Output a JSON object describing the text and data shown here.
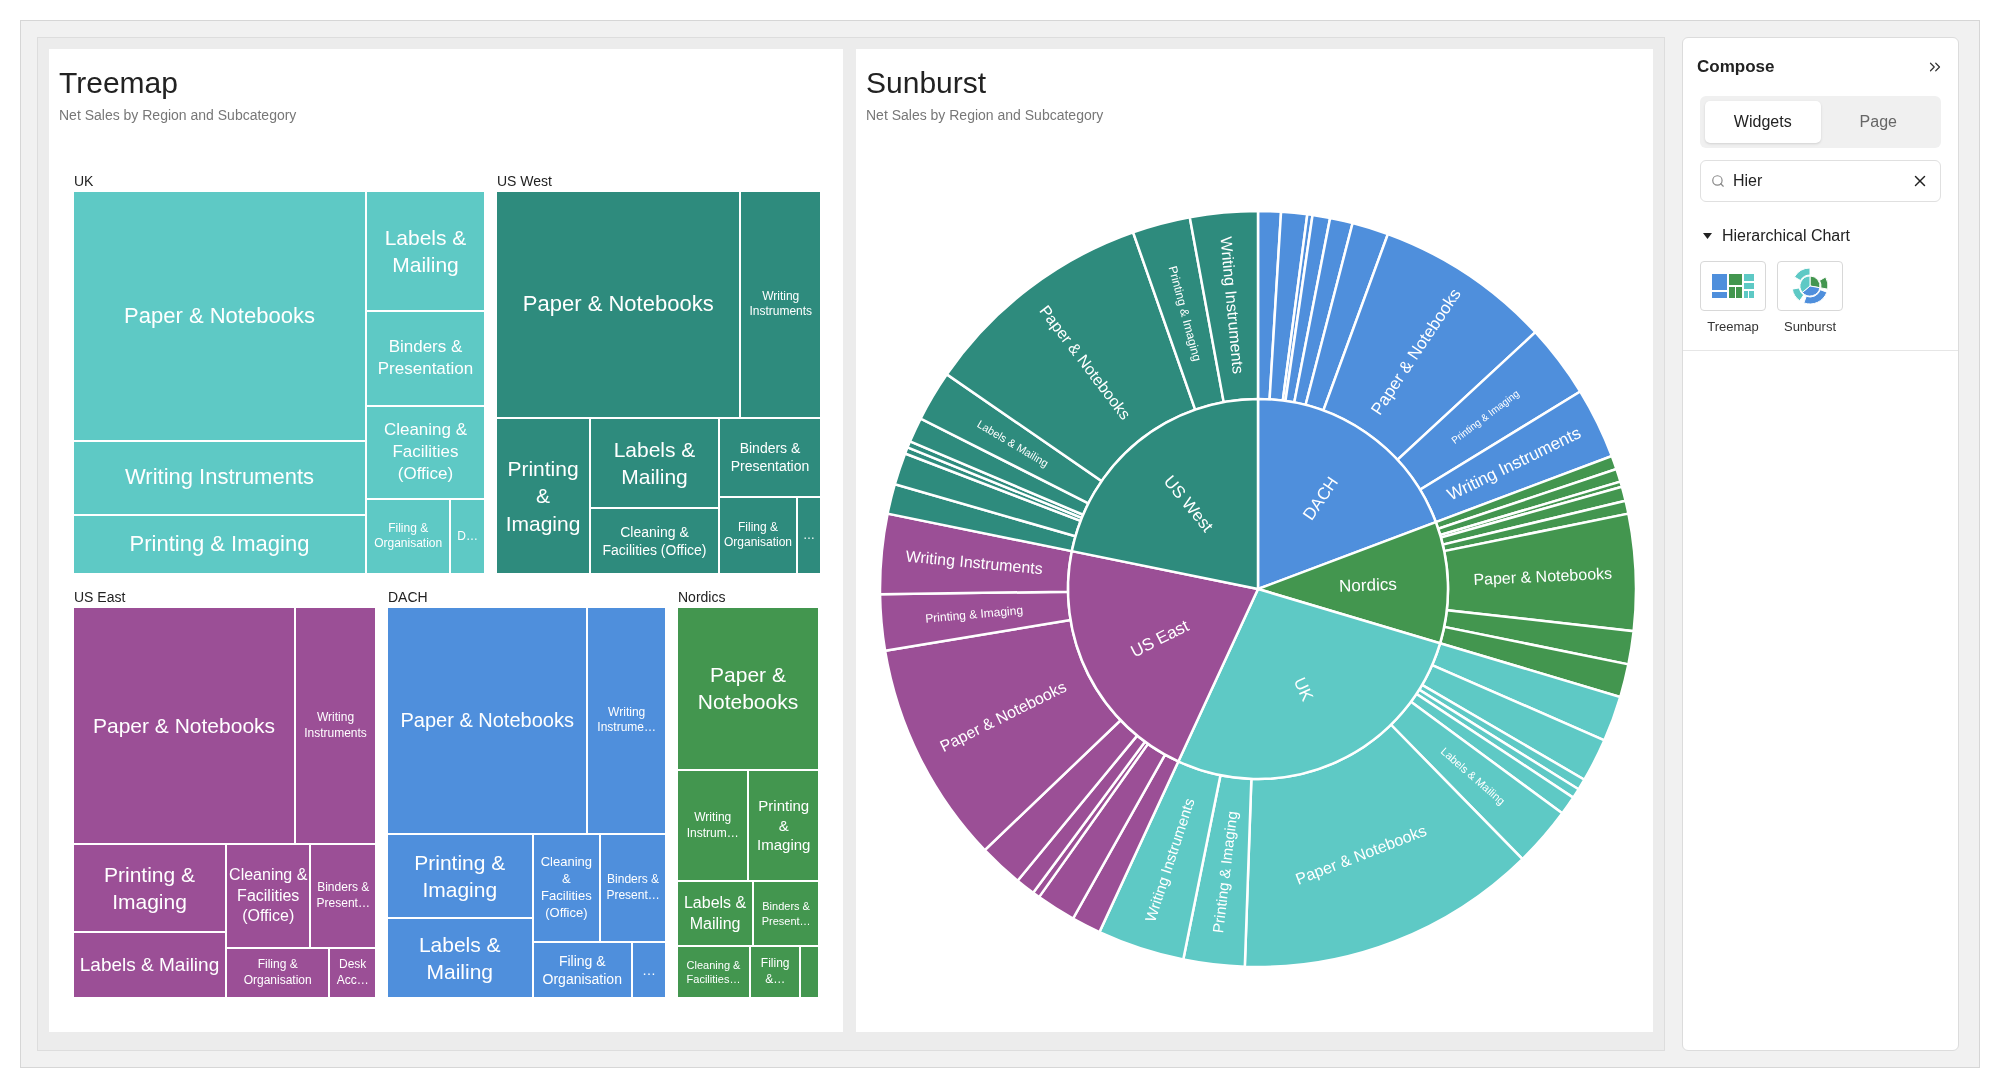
{
  "treemap": {
    "title": "Treemap",
    "subtitle": "Net Sales by Region and Subcategory",
    "regions": [
      {
        "name": "UK",
        "color": "#5ec9c5",
        "cells": [
          "Paper & Notebooks",
          "Writing Instruments",
          "Printing & Imaging",
          "Labels & Mailing",
          "Binders & Presentation",
          "Cleaning & Facilities (Office)",
          "Filing & Organisation",
          "D…"
        ]
      },
      {
        "name": "US West",
        "color": "#2e8b7d",
        "cells": [
          "Paper & Notebooks",
          "Writing Instruments",
          "Printing & Imaging",
          "Labels & Mailing",
          "Cleaning & Facilities (Office)",
          "Binders & Presentation",
          "Filing & Organisation",
          "…"
        ]
      },
      {
        "name": "US East",
        "color": "#9b4f96",
        "cells": [
          "Paper & Notebooks",
          "Writing Instruments",
          "Printing & Imaging",
          "Labels & Mailing",
          "Cleaning & Facilities (Office)",
          "Binders & Present…",
          "Filing & Organisation",
          "Desk Acc…"
        ]
      },
      {
        "name": "DACH",
        "color": "#4f8fdc",
        "cells": [
          "Paper & Notebooks",
          "Writing Instrume…",
          "Printing & Imaging",
          "Labels & Mailing",
          "Cleaning & Facilities (Office)",
          "Binders & Present…",
          "Filing & Organisation",
          "…"
        ]
      },
      {
        "name": "Nordics",
        "color": "#43964f",
        "cells": [
          "Paper & Notebooks",
          "Writing Instrum…",
          "Printing & Imaging",
          "Labels & Mailing",
          "Binders & Present…",
          "Cleaning & Facilities…",
          "Filing &…"
        ]
      }
    ]
  },
  "sunburst": {
    "title": "Sunburst",
    "subtitle": "Net Sales by Region and Subcategory",
    "regions": [
      {
        "name": "DACH",
        "color": "#4f8fdc",
        "segments": [
          "Paper & Notebooks",
          "Printing & Imaging",
          "Writing Instruments"
        ]
      },
      {
        "name": "Nordics",
        "color": "#43964f",
        "segments": [
          "Paper & Notebooks"
        ]
      },
      {
        "name": "UK",
        "color": "#5ec9c5",
        "segments": [
          "Labels & Mailing",
          "Paper & Notebooks",
          "Printing & Imaging",
          "Writing Instruments"
        ]
      },
      {
        "name": "US East",
        "color": "#9b4f96",
        "segments": [
          "Paper & Notebooks",
          "Printing & Imaging",
          "Writing Instruments"
        ]
      },
      {
        "name": "US West",
        "color": "#2e8b7d",
        "segments": [
          "Labels & Mailing",
          "Paper & Notebooks",
          "Printing & Imaging",
          "Writing Instruments"
        ]
      }
    ]
  },
  "compose": {
    "title": "Compose",
    "tabs": [
      {
        "label": "Widgets",
        "selected": true
      },
      {
        "label": "Page",
        "selected": false
      }
    ],
    "search": {
      "value": "Hier"
    },
    "section": {
      "title": "Hierarchical Chart",
      "expanded": true,
      "items": [
        {
          "label": "Treemap",
          "kind": "treemap"
        },
        {
          "label": "Sunburst",
          "kind": "sunburst"
        }
      ]
    }
  }
}
